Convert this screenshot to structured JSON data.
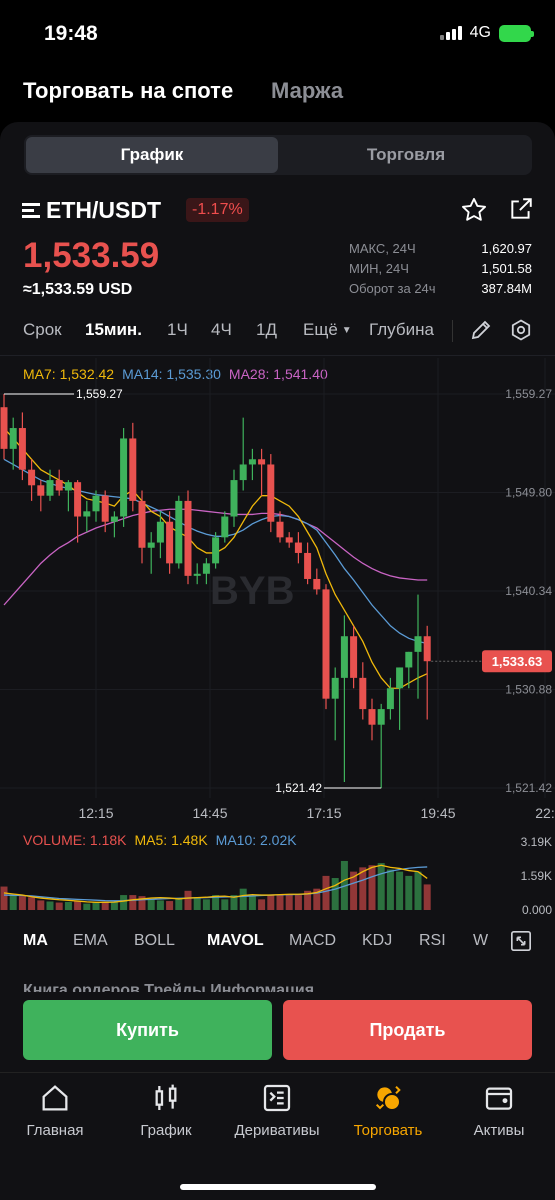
{
  "status": {
    "time": "19:48",
    "network": "4G"
  },
  "top_tabs": [
    {
      "label": "Торговать на споте"
    },
    {
      "label": "Маржа"
    }
  ],
  "segment": [
    {
      "label": "График"
    },
    {
      "label": "Торговля"
    }
  ],
  "pair": {
    "symbol": "ETH/USDT",
    "change": "-1.17%",
    "price": "1,533.59",
    "price_usd": "≈1,533.59 USD"
  },
  "stats": [
    {
      "label": "МАКС, 24Ч",
      "value": "1,620.97"
    },
    {
      "label": "МИН, 24Ч",
      "value": "1,501.58"
    },
    {
      "label": "Оборот за 24ч",
      "value": "387.84M"
    }
  ],
  "timeframes": [
    "Срок",
    "15мин.",
    "1Ч",
    "4Ч",
    "1Д",
    "Ещё",
    "Глубина"
  ],
  "timeframe_active": "15мин.",
  "ma_legend": {
    "ma7": "MA7: 1,532.42",
    "ma14": "MA14: 1,535.30",
    "ma28": "MA28: 1,541.40"
  },
  "colors": {
    "up": "#3fb25c",
    "down": "#e8524f",
    "ma7": "#f0b90b",
    "ma14": "#5b9bd5",
    "ma28": "#c964c4",
    "accent": "#f7a600"
  },
  "price_axis": [
    "1,559.27",
    "1,549.80",
    "1,540.34",
    "1,530.88",
    "1,521.42"
  ],
  "current_price_tag": "1,533.63",
  "high_marker": "1,559.27",
  "low_marker": "1,521.42",
  "time_axis": [
    "12:15",
    "14:45",
    "17:15",
    "19:45",
    "22:"
  ],
  "watermark": "BYB",
  "volume_legend": {
    "volume": "VOLUME: 1.18K",
    "ma5": "MA5: 1.48K",
    "ma10": "MA10: 2.02K"
  },
  "volume_axis": [
    "3.19K",
    "1.59K",
    "0.000"
  ],
  "indicators": [
    "MA",
    "EMA",
    "BOLL",
    "MAVOL",
    "MACD",
    "KDJ",
    "RSI",
    "W"
  ],
  "indicator_active": [
    "MA",
    "MAVOL"
  ],
  "order_tabs_partial": "Книга ордеров    Трейды    Информация",
  "buttons": {
    "buy": "Купить",
    "sell": "Продать"
  },
  "nav": [
    {
      "label": "Главная",
      "icon": "home-icon"
    },
    {
      "label": "График",
      "icon": "candlestick-icon"
    },
    {
      "label": "Деривативы",
      "icon": "derivatives-icon"
    },
    {
      "label": "Торговать",
      "icon": "trade-icon"
    },
    {
      "label": "Активы",
      "icon": "wallet-icon"
    }
  ],
  "nav_active": "Торговать",
  "chart_data": {
    "type": "candlestick",
    "ylim": [
      1521.42,
      1559.27
    ],
    "candles": [
      [
        1558,
        1559.27,
        1553,
        1554
      ],
      [
        1554,
        1557,
        1552,
        1556
      ],
      [
        1556,
        1557.5,
        1551,
        1552
      ],
      [
        1552,
        1553,
        1549,
        1550.5
      ],
      [
        1550.5,
        1551,
        1548,
        1549.5
      ],
      [
        1549.5,
        1552,
        1549,
        1551
      ],
      [
        1551,
        1552,
        1549.5,
        1550
      ],
      [
        1550,
        1551,
        1548,
        1550.8
      ],
      [
        1550.8,
        1551,
        1545,
        1547.5
      ],
      [
        1547.5,
        1549,
        1546,
        1548
      ],
      [
        1548,
        1550,
        1547,
        1549.5
      ],
      [
        1549.5,
        1550,
        1546,
        1547
      ],
      [
        1547,
        1548,
        1545.5,
        1547.5
      ],
      [
        1547.5,
        1556,
        1546.5,
        1555
      ],
      [
        1555,
        1556.5,
        1548,
        1549
      ],
      [
        1549,
        1550,
        1543,
        1544.5
      ],
      [
        1544.5,
        1546,
        1542,
        1545
      ],
      [
        1545,
        1548,
        1543.5,
        1547
      ],
      [
        1547,
        1548,
        1542,
        1543
      ],
      [
        1543,
        1549.5,
        1542.5,
        1549
      ],
      [
        1549,
        1550,
        1541,
        1541.8
      ],
      [
        1541.8,
        1543,
        1541,
        1542
      ],
      [
        1542,
        1543.5,
        1541,
        1543
      ],
      [
        1543,
        1546,
        1542.5,
        1545.5
      ],
      [
        1545.5,
        1548,
        1545,
        1547.5
      ],
      [
        1547.5,
        1552,
        1546.5,
        1551
      ],
      [
        1551,
        1557,
        1550,
        1552.5
      ],
      [
        1552.5,
        1554,
        1551,
        1553
      ],
      [
        1553,
        1554,
        1549.5,
        1552.5
      ],
      [
        1552.5,
        1553.5,
        1546,
        1547
      ],
      [
        1547,
        1548,
        1545,
        1545.5
      ],
      [
        1545.5,
        1546,
        1544.5,
        1545
      ],
      [
        1545,
        1546,
        1543,
        1544
      ],
      [
        1544,
        1545,
        1541,
        1541.5
      ],
      [
        1541.5,
        1542.5,
        1540,
        1540.5
      ],
      [
        1540.5,
        1541,
        1529,
        1530
      ],
      [
        1530,
        1533,
        1526,
        1532
      ],
      [
        1532,
        1538,
        1522,
        1536
      ],
      [
        1536,
        1537,
        1531,
        1532
      ],
      [
        1532,
        1533.5,
        1528,
        1529
      ],
      [
        1529,
        1530,
        1526,
        1527.5
      ],
      [
        1527.5,
        1529.5,
        1521.42,
        1529
      ],
      [
        1529,
        1532,
        1528,
        1531
      ],
      [
        1531,
        1533,
        1527,
        1533
      ],
      [
        1533,
        1534.5,
        1531,
        1534.5
      ],
      [
        1534.5,
        1540,
        1530,
        1536
      ],
      [
        1536,
        1537,
        1528,
        1533.6
      ]
    ],
    "ma7": [
      1556,
      1555,
      1554,
      1553,
      1552,
      1551.5,
      1551,
      1550.5,
      1549.8,
      1549.2,
      1549,
      1548.8,
      1548.5,
      1549.5,
      1550,
      1549,
      1548,
      1547.5,
      1546.5,
      1546,
      1545.5,
      1544.5,
      1544,
      1544,
      1544.5,
      1545.5,
      1547,
      1548.5,
      1549.5,
      1549.5,
      1549,
      1548.5,
      1547.5,
      1546,
      1544.5,
      1542,
      1540,
      1538.5,
      1537,
      1535.5,
      1533.5,
      1532,
      1531,
      1531,
      1531.5,
      1532,
      1532.4
    ],
    "ma14": [
      1553,
      1552.5,
      1552,
      1551.5,
      1551,
      1550.7,
      1550.4,
      1550.2,
      1550,
      1549.8,
      1549.6,
      1549.5,
      1549.4,
      1549.3,
      1549.2,
      1548.8,
      1548.4,
      1548,
      1547.5,
      1547,
      1546.5,
      1546.1,
      1545.8,
      1545.6,
      1545.6,
      1545.8,
      1546.2,
      1546.8,
      1547.2,
      1547.5,
      1547.6,
      1547.5,
      1547.2,
      1546.8,
      1546.2,
      1545,
      1543.8,
      1542.5,
      1541.4,
      1540.2,
      1539,
      1538,
      1537,
      1536.3,
      1535.8,
      1535.5,
      1535.3
    ],
    "ma28": [
      1539,
      1540,
      1541,
      1542,
      1543,
      1543.8,
      1544.5,
      1545,
      1545.6,
      1546,
      1546.4,
      1546.7,
      1547,
      1547.3,
      1547.6,
      1547.8,
      1548,
      1548.1,
      1548.2,
      1548.2,
      1548.2,
      1548.1,
      1548,
      1547.9,
      1547.8,
      1547.7,
      1547.7,
      1547.7,
      1547.8,
      1547.8,
      1547.7,
      1547.5,
      1547.2,
      1546.8,
      1546.4,
      1545.7,
      1545,
      1544.3,
      1543.6,
      1543,
      1542.5,
      1542.1,
      1541.8,
      1541.6,
      1541.5,
      1541.4,
      1541.4
    ],
    "volume_ylim": [
      0,
      3190
    ],
    "volume": [
      1100,
      700,
      650,
      600,
      450,
      400,
      350,
      380,
      420,
      300,
      350,
      400,
      380,
      700,
      700,
      650,
      500,
      450,
      420,
      520,
      900,
      600,
      500,
      700,
      500,
      700,
      1000,
      650,
      500,
      700,
      700,
      750,
      700,
      900,
      1000,
      1600,
      1500,
      2300,
      1800,
      2000,
      2100,
      2200,
      1900,
      1800,
      1600,
      1800,
      1200
    ],
    "vol_ma5": [
      800,
      750,
      700,
      620,
      560,
      520,
      480,
      450,
      420,
      380,
      360,
      360,
      370,
      420,
      480,
      520,
      560,
      580,
      560,
      520,
      560,
      580,
      600,
      640,
      650,
      600,
      680,
      720,
      700,
      700,
      720,
      740,
      740,
      760,
      820,
      1000,
      1150,
      1400,
      1550,
      1800,
      2000,
      2100,
      2000,
      1950,
      1850,
      1800,
      1480
    ],
    "vol_ma10": [
      700,
      690,
      680,
      660,
      620,
      580,
      540,
      520,
      500,
      480,
      460,
      440,
      430,
      440,
      460,
      480,
      500,
      520,
      540,
      550,
      560,
      570,
      580,
      600,
      610,
      620,
      640,
      660,
      680,
      700,
      710,
      720,
      730,
      750,
      790,
      880,
      980,
      1120,
      1260,
      1400,
      1560,
      1700,
      1820,
      1900,
      1960,
      2000,
      2020
    ]
  }
}
